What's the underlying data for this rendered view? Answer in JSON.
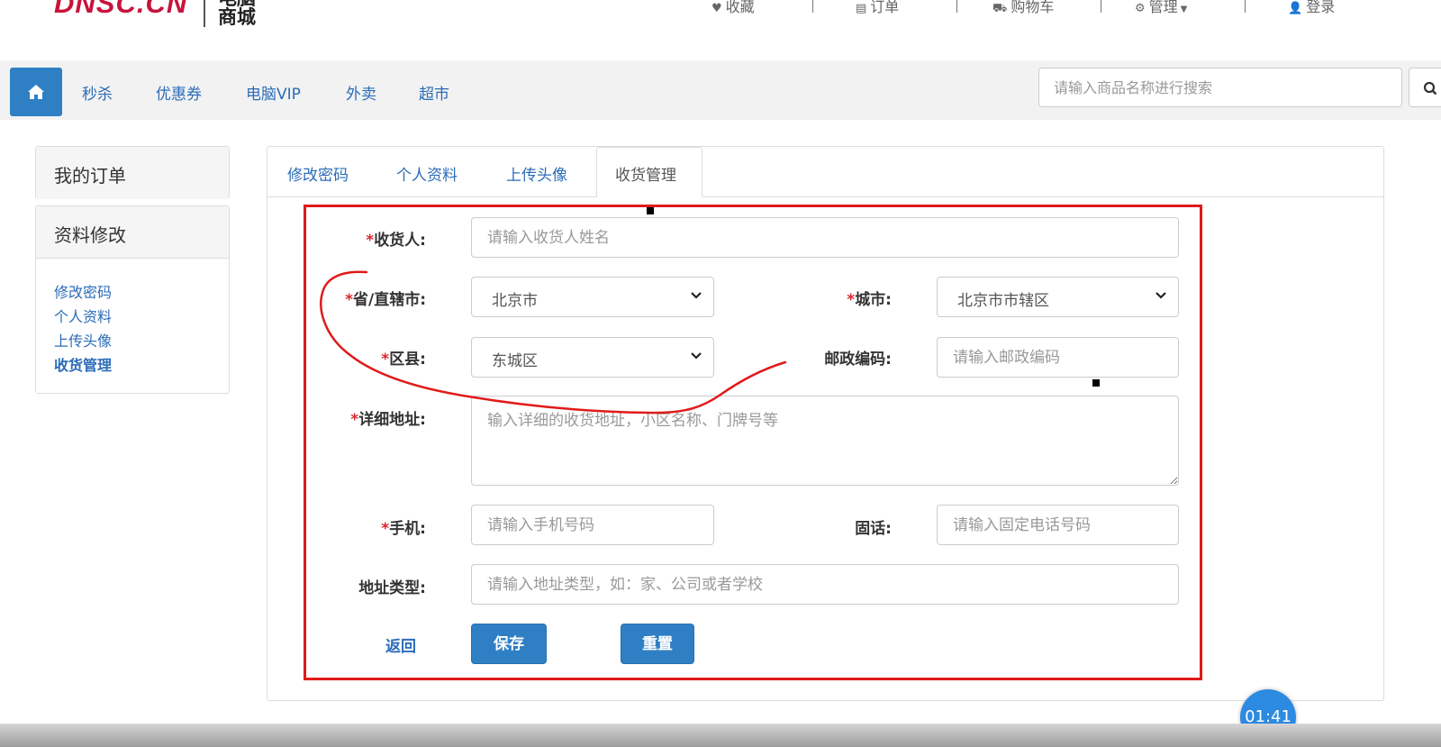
{
  "header": {
    "logo_text": "DNSC.CN",
    "logo_sub_line1": "电脑",
    "logo_sub_line2": "商城",
    "top_nav": [
      {
        "icon": "heart-icon",
        "label": "收藏"
      },
      {
        "icon": "document-icon",
        "label": "订单"
      },
      {
        "icon": "cart-icon",
        "label": "购物车"
      },
      {
        "icon": "gears-icon",
        "label": "管理"
      },
      {
        "icon": "user-icon",
        "label": "登录"
      }
    ]
  },
  "navbar": {
    "home_icon": "home-icon",
    "links": [
      "秒杀",
      "优惠券",
      "电脑VIP",
      "外卖",
      "超市"
    ],
    "search_placeholder": "请输入商品名称进行搜索",
    "search_icon": "search-icon"
  },
  "sidebar": {
    "orders_heading": "我的订单",
    "profile_heading": "资料修改",
    "links": [
      "修改密码",
      "个人资料",
      "上传头像",
      "收货管理"
    ]
  },
  "tabs": [
    "修改密码",
    "个人资料",
    "上传头像",
    "收货管理"
  ],
  "form": {
    "required_mark": "*",
    "receiver": {
      "label": "收货人:",
      "placeholder": "请输入收货人姓名"
    },
    "province": {
      "label": "省/直辖市:",
      "value": "北京市"
    },
    "city": {
      "label": "城市:",
      "value": "北京市市辖区"
    },
    "district": {
      "label": "区县:",
      "value": "东城区"
    },
    "postcode": {
      "label": "邮政编码:",
      "placeholder": "请输入邮政编码"
    },
    "address": {
      "label": "详细地址:",
      "placeholder": "输入详细的收货地址，小区名称、门牌号等"
    },
    "mobile": {
      "label": "手机:",
      "placeholder": "请输入手机号码"
    },
    "phone": {
      "label": "固话:",
      "placeholder": "请输入固定电话号码"
    },
    "address_type": {
      "label": "地址类型:",
      "placeholder": "请输入地址类型，如：家、公司或者学校"
    },
    "back_label": "返回",
    "save_label": "保存",
    "reset_label": "重置"
  },
  "timer": "01:41",
  "colors": {
    "primary": "#2f7fc4",
    "link": "#2b6cb8",
    "annotation_red": "#e01a1a",
    "required": "#d9272e"
  }
}
